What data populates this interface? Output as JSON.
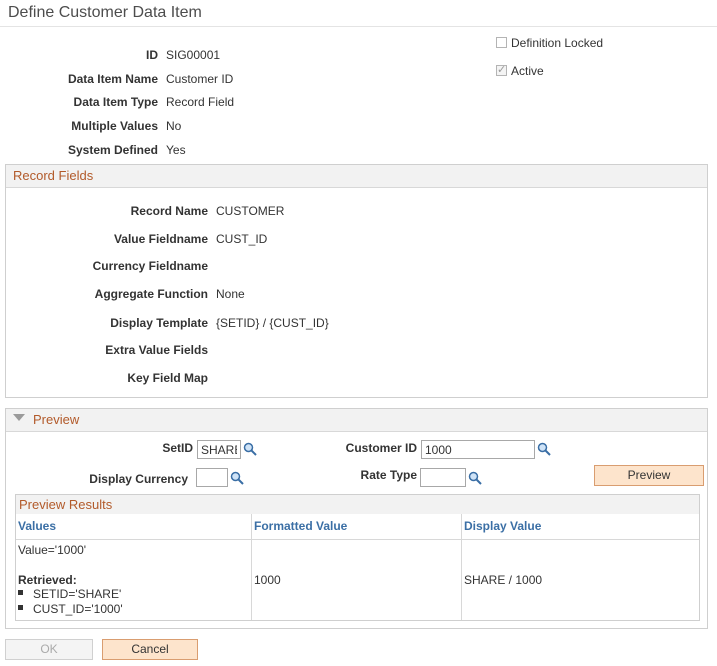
{
  "page": {
    "title": "Define Customer Data Item"
  },
  "summary": {
    "id_label": "ID",
    "id_value": "SIG00001",
    "name_label": "Data Item Name",
    "name_value": "Customer ID",
    "type_label": "Data Item Type",
    "type_value": "Record Field",
    "multi_label": "Multiple Values",
    "multi_value": "No",
    "sysdef_label": "System Defined",
    "sysdef_value": "Yes",
    "locked_label": "Definition Locked",
    "locked_checked": false,
    "active_label": "Active",
    "active_checked": true
  },
  "record_fields": {
    "header": "Record Fields",
    "record_name_label": "Record Name",
    "record_name_value": "CUSTOMER",
    "value_field_label": "Value Fieldname",
    "value_field_value": "CUST_ID",
    "currency_label": "Currency Fieldname",
    "currency_value": "",
    "aggregate_label": "Aggregate Function",
    "aggregate_value": "None",
    "template_label": "Display Template",
    "template_value": "{SETID} / {CUST_ID}",
    "extra_label": "Extra Value Fields",
    "extra_value": "",
    "keymap_label": "Key Field Map",
    "keymap_value": ""
  },
  "preview": {
    "header": "Preview",
    "setid_label": "SetID",
    "setid_value": "SHARE",
    "customer_label": "Customer ID",
    "customer_value": "1000",
    "currency_label": "Display Currency",
    "currency_value": "",
    "ratetype_label": "Rate Type",
    "ratetype_value": "",
    "button_label": "Preview",
    "results": {
      "header": "Preview Results",
      "columns": [
        "Values",
        "Formatted Value",
        "Display Value"
      ],
      "row": {
        "value_line": "Value='1000'",
        "retrieved_label": "Retrieved:",
        "retrieved_items": [
          "SETID='SHARE'",
          "CUST_ID='1000'"
        ],
        "formatted": "1000",
        "display": "SHARE / 1000"
      }
    }
  },
  "footer": {
    "ok_label": "OK",
    "cancel_label": "Cancel"
  },
  "colors": {
    "accent_header": "#b25a2a",
    "column_header": "#3b6fa5",
    "button_bg": "#fde4cc"
  },
  "icons": {
    "lookup": "magnifier-icon",
    "collapse": "triangle-down-icon"
  }
}
